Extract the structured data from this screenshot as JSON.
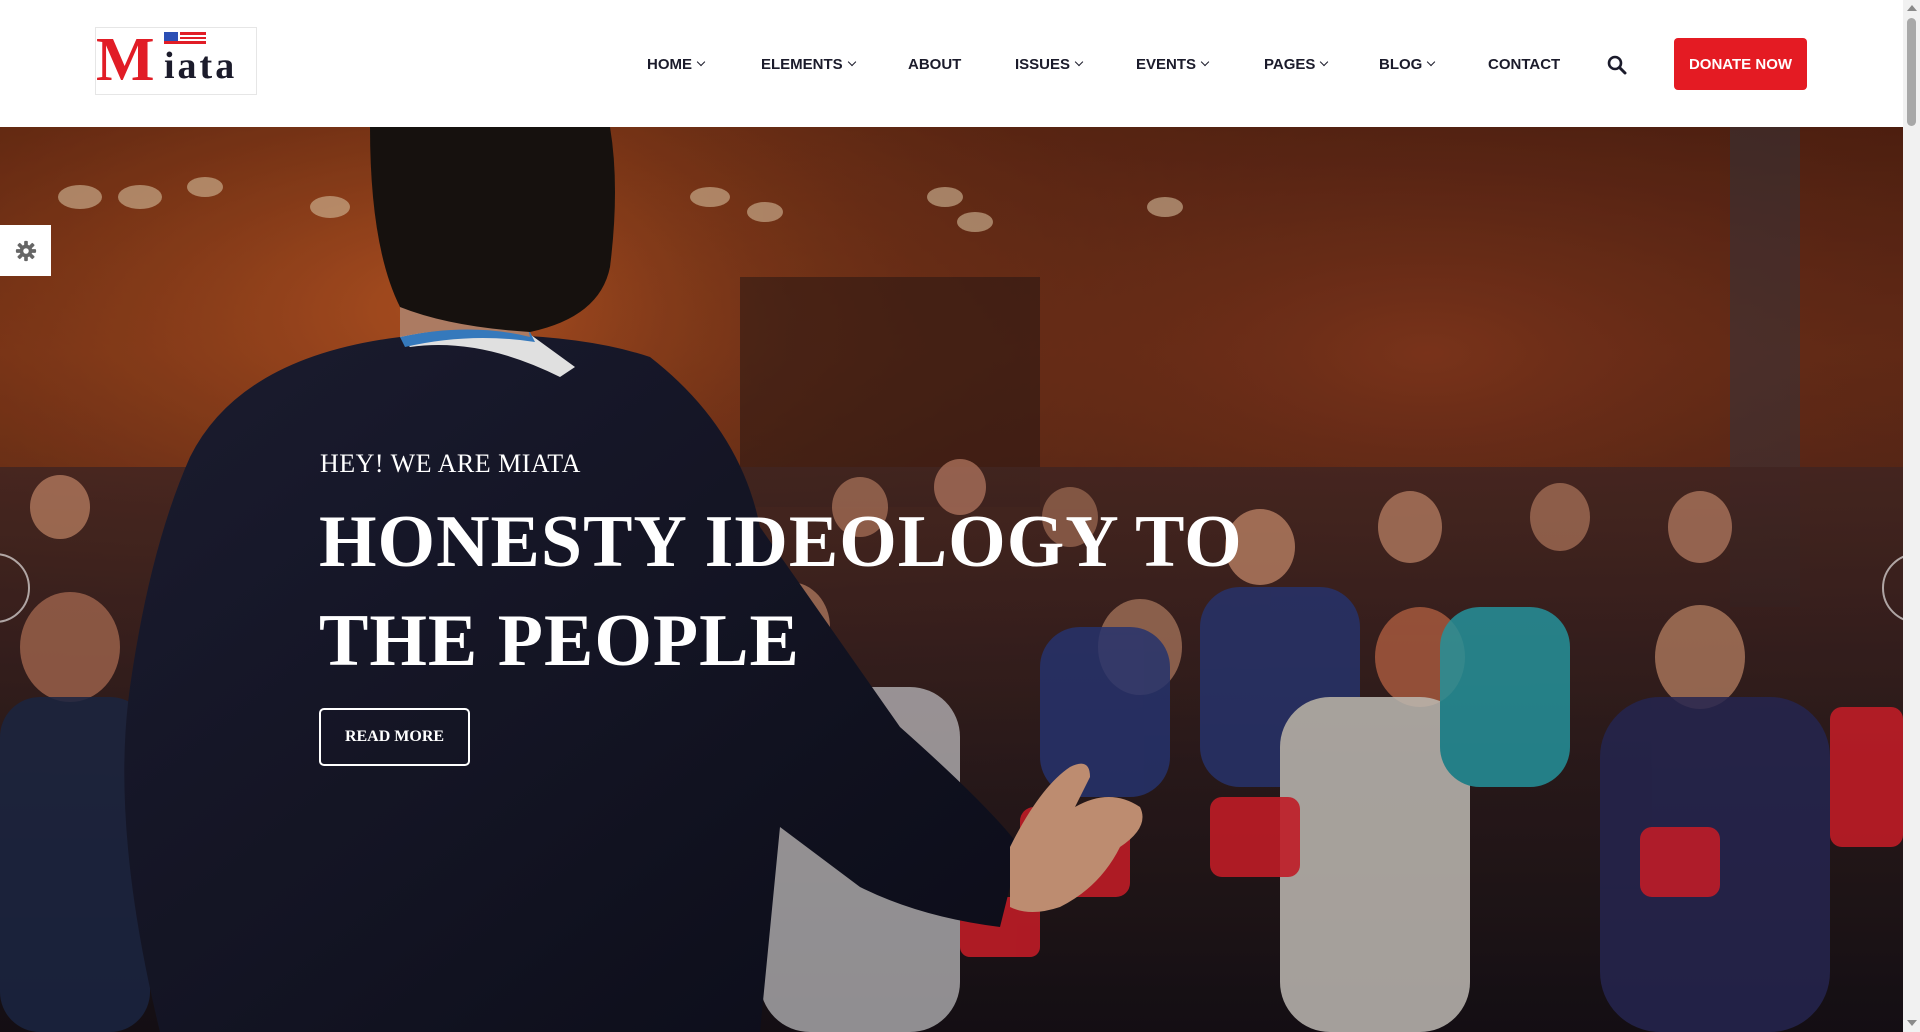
{
  "logo": {
    "initial": "M",
    "rest": "iata"
  },
  "nav": {
    "items": [
      {
        "label": "HOME",
        "has_dropdown": true
      },
      {
        "label": "ELEMENTS",
        "has_dropdown": true
      },
      {
        "label": "ABOUT",
        "has_dropdown": false
      },
      {
        "label": "ISSUES",
        "has_dropdown": true
      },
      {
        "label": "EVENTS",
        "has_dropdown": true
      },
      {
        "label": "PAGES",
        "has_dropdown": true
      },
      {
        "label": "BLOG",
        "has_dropdown": true
      },
      {
        "label": "CONTACT",
        "has_dropdown": false
      }
    ],
    "search_icon": "search-icon",
    "donate_label": "DONATE NOW"
  },
  "hero": {
    "subtitle": "HEY! WE ARE MIATA",
    "title_line1": "HONESTY IDEOLOGY TO",
    "title_line2": "THE PEOPLE",
    "button_label": "READ MORE",
    "settings_icon": "gear-icon"
  },
  "colors": {
    "accent": "#e41b23",
    "text_dark": "#1b1b2b",
    "header_bg": "#ffffff"
  }
}
